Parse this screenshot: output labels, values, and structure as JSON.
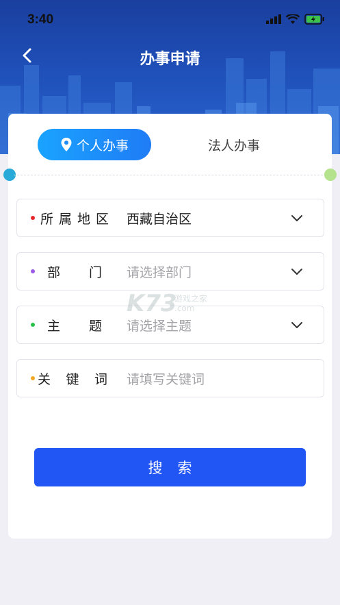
{
  "status_bar": {
    "time": "3:40",
    "icons": [
      "signal-icon",
      "wifi-icon",
      "battery-icon"
    ]
  },
  "nav": {
    "title": "办事申请",
    "back_icon": "chevron-left-icon"
  },
  "tabs": [
    {
      "label": "个人办事",
      "icon": "location-pin-icon",
      "active": true
    },
    {
      "label": "法人办事",
      "active": false
    }
  ],
  "form": {
    "region": {
      "label_chars": [
        "所",
        "属",
        "地",
        "区"
      ],
      "value": "西藏自治区",
      "dot_color": "#e8262a"
    },
    "department": {
      "label_chars": [
        "部",
        "门"
      ],
      "placeholder": "请选择部门",
      "dot_color": "#9b59e6"
    },
    "topic": {
      "label_chars": [
        "主",
        "题"
      ],
      "placeholder": "请选择主题",
      "dot_color": "#29c24a"
    },
    "keyword": {
      "label_chars": [
        "关",
        "键",
        "词"
      ],
      "placeholder": "请填写关键词",
      "dot_color": "#f5a623"
    }
  },
  "search_button": {
    "label": "搜索"
  },
  "watermark": {
    "main": "K73",
    "sub": "游戏之家",
    "suffix": ".com"
  },
  "colors": {
    "header": "#1f4fb8",
    "primary_button": "#2155f4",
    "active_tab": "#1f7cf5"
  }
}
